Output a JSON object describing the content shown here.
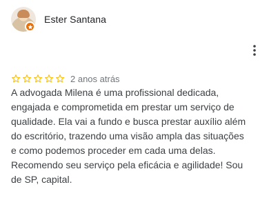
{
  "review": {
    "reviewer_name": "Ester Santana",
    "rating": 5,
    "rating_max": 5,
    "date": "2 anos atrás",
    "text": "A advogada Milena é uma profissional dedicada,\nengajada e comprometida em prestar um serviço de\nqualidade. Ela vai a fundo e busca prestar auxílio além\ndo escritório, trazendo uma visão ampla das situações\ne como podemos proceder em cada uma delas.\nRecomendo seu serviço pela eficácia e agilidade! Sou\nde SP, capital."
  },
  "icons": {
    "avatar": "avatar",
    "badge": "local-guide-badge-icon",
    "more": "more-vert-icon",
    "star": "star-outline-icon"
  },
  "colors": {
    "star": "#fbbc04",
    "badge": "#e8710a",
    "secondary_text": "#70757a"
  }
}
